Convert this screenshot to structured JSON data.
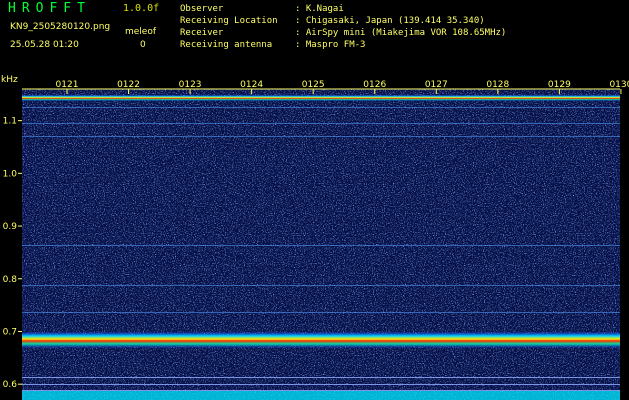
{
  "header": {
    "app_title": "HROFFT",
    "version": "1.0.0f",
    "filename": "KN9_2505280120.png",
    "datetime": "25.05.28 01:20",
    "mode_label": "meleof",
    "mode_value": "0"
  },
  "info": [
    {
      "label": "Observer",
      "value": "K.Nagai"
    },
    {
      "label": "Receiving Location",
      "value": "Chigasaki, Japan (139.414 35.340)"
    },
    {
      "label": "Receiver",
      "value": "AirSpy mini (Miakejima VOR 108.65MHz)"
    },
    {
      "label": "Receiving antenna",
      "value": "Maspro FM-3"
    }
  ],
  "plot": {
    "unit_label": "kHz",
    "time_ticks": [
      "0121",
      "0122",
      "0123",
      "0124",
      "0125",
      "0126",
      "0127",
      "0128",
      "0129",
      "0130"
    ],
    "freq_ticks": [
      "1.1",
      "1.0",
      "0.9",
      "0.8",
      "0.7",
      "0.6"
    ],
    "freq_range_khz": [
      0.57,
      1.16
    ],
    "strong_lines_khz": [
      1.143,
      0.684
    ],
    "faint_lines_khz": [
      1.126,
      1.095,
      1.071,
      0.864,
      0.789,
      0.736,
      0.613,
      0.601,
      0.589
    ],
    "colors": {
      "background": "#061048",
      "label": "#ffff66",
      "title": "#00ff33",
      "bottom_band": "#00e8ff"
    }
  }
}
